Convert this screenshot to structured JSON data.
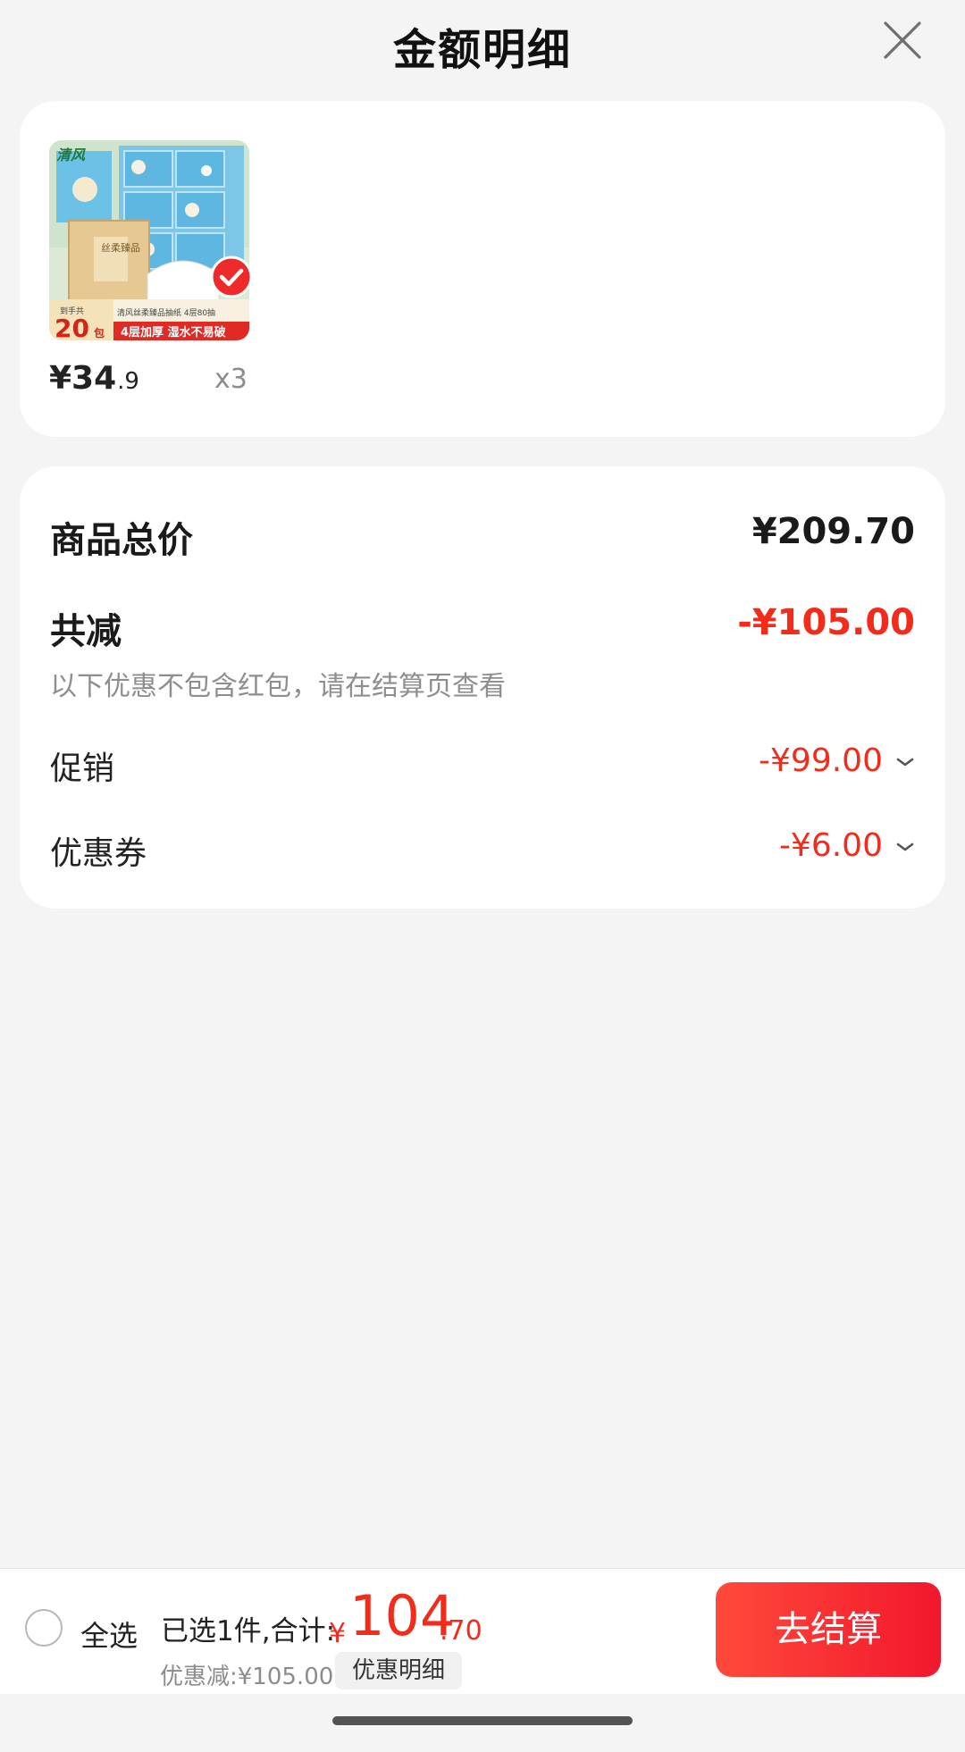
{
  "header": {
    "title": "金额明细",
    "close_icon": "close-icon"
  },
  "product": {
    "price_main": "¥34",
    "price_decimal": ".9",
    "quantity": "x3",
    "thumbnail": {
      "brand": "清风",
      "box_label": "丝柔臻品",
      "product_line": "清风丝柔臻品抽纸  4层80抽",
      "count_prefix": "到手共",
      "count_value": "20",
      "count_unit": "包",
      "feature_banner": "4层加厚  湿水不易破",
      "colors": {
        "sky": "#6fc7e6",
        "red": "#e02a24",
        "cream": "#f7e8c8"
      }
    },
    "selected": true
  },
  "summary": {
    "total_label": "商品总价",
    "total_value": "¥209.70",
    "discount_label": "共减",
    "discount_value": "-¥105.00",
    "note": "以下优惠不包含红包，请在结算页查看",
    "items": [
      {
        "label": "促销",
        "value": "-¥99.00"
      },
      {
        "label": "优惠券",
        "value": "-¥6.00"
      }
    ]
  },
  "bottom": {
    "select_all": "全选",
    "selected_text": "已选1件,合计:",
    "currency": "¥",
    "total_int": "104",
    "total_dec": ".70",
    "discount_text": "优惠减:¥105.00",
    "detail_button": "优惠明细",
    "checkout_button": "去结算"
  },
  "colors": {
    "accent": "#f22b1b",
    "background": "#f4f4f4",
    "card": "#ffffff"
  }
}
